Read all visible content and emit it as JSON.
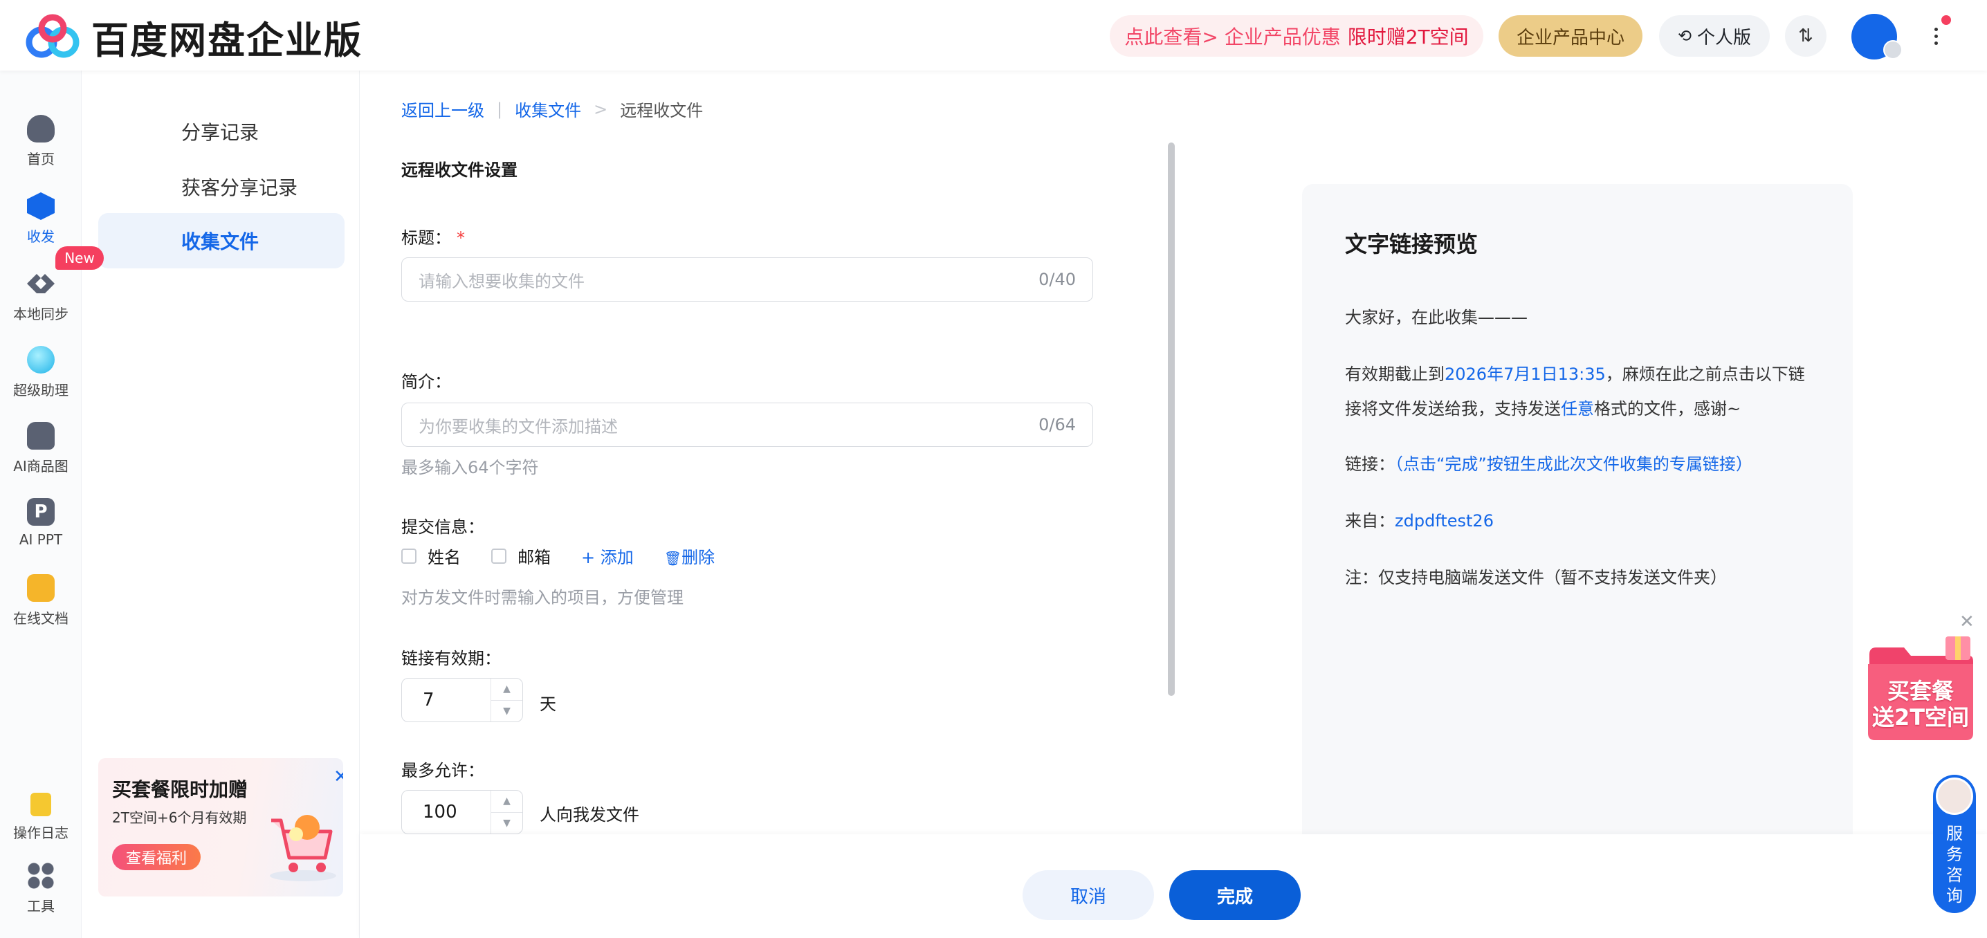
{
  "header": {
    "logo_text": "百度网盘企业版",
    "promo_prefix": "点此查看> 企业产品优惠",
    "promo_hot": "限时赠2T空间",
    "enterprise_btn": "企业产品中心",
    "personal_btn": "个人版",
    "transfer_icon": "⇅"
  },
  "leftnav": {
    "items": [
      {
        "label": "首页",
        "icon": "home-icon"
      },
      {
        "label": "收发",
        "icon": "transfer-icon"
      },
      {
        "label": "本地同步",
        "icon": "sync-icon"
      },
      {
        "label": "超级助理",
        "icon": "assistant-icon"
      },
      {
        "label": "AI商品图",
        "icon": "ai-image-icon"
      },
      {
        "label": "AI PPT",
        "icon": "ppt-icon"
      },
      {
        "label": "在线文档",
        "icon": "docs-icon"
      },
      {
        "label": "操作日志",
        "icon": "log-icon"
      },
      {
        "label": "工具",
        "icon": "tools-icon"
      }
    ],
    "new_badge": "New"
  },
  "subnav": {
    "items": [
      {
        "label": "分享记录"
      },
      {
        "label": "获客分享记录"
      },
      {
        "label": "收集文件"
      }
    ],
    "promo": {
      "title": "买套餐限时加赠",
      "subtitle": "2T空间+6个月有效期",
      "cta": "查看福利",
      "close": "✕"
    }
  },
  "breadcrumb": {
    "back": "返回上一级",
    "sep1": "|",
    "parent": "收集文件",
    "sep2": ">",
    "current": "远程收文件"
  },
  "form": {
    "section_title": "远程收文件设置",
    "title_label": "标题：",
    "required_mark": "*",
    "title_placeholder": "请输入想要收集的文件",
    "title_count": "0/40",
    "desc_label": "简介：",
    "desc_placeholder": "为你要收集的文件添加描述",
    "desc_count": "0/64",
    "desc_hint": "最多输入64个字符",
    "submit_label": "提交信息：",
    "check_name": "姓名",
    "check_email": "邮箱",
    "add_link": "+ 添加",
    "delete_link": "删除",
    "submit_hint": "对方发文件时需输入的项目，方便管理",
    "expiry_label": "链接有效期：",
    "expiry_value": "7",
    "expiry_unit": "天",
    "max_label": "最多允许：",
    "max_value": "100",
    "max_unit": "人向我发文件"
  },
  "preview": {
    "title": "文字链接预览",
    "greeting": "大家好，在此收集———",
    "expiry_prefix": "有效期截止到",
    "expiry_date": "2026年7月1日13:35",
    "expiry_suffix": "，麻烦在此之前点击以下链",
    "expiry_line2_prefix": "接将文件发送给我，支持发送",
    "expiry_any": "任意",
    "expiry_line2_suffix": "格式的文件，感谢~",
    "link_label": "链接：",
    "link_text": "（点击“完成”按钮生成此次文件收集的专属链接）",
    "from_label": "来自：",
    "from_user": "zdpdftest26",
    "note": "注：仅支持电脑端发送文件（暂不支持发送文件夹）"
  },
  "actions": {
    "cancel": "取消",
    "done": "完成"
  },
  "float": {
    "promo_line1": "买套餐",
    "promo_line2": "送2T空间",
    "close": "✕",
    "service_text": "服务咨询"
  },
  "colors": {
    "accent": "#1467e8",
    "danger": "#f53f5f",
    "gold": "#eccc88"
  }
}
